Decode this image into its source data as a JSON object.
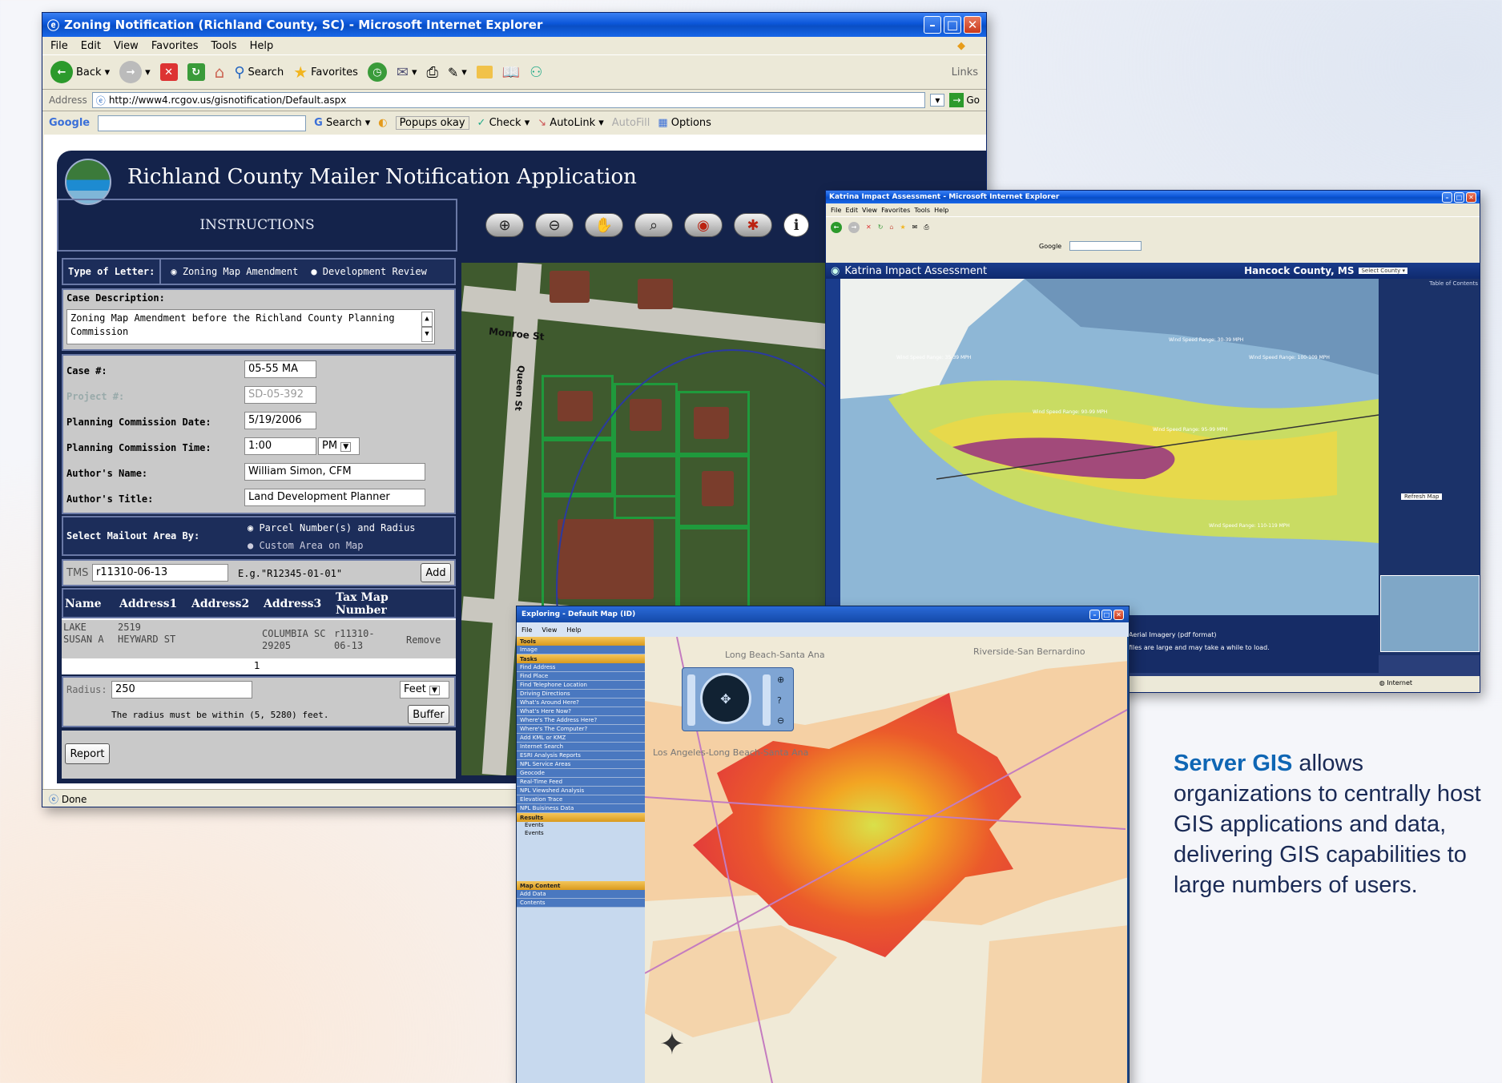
{
  "window_main": {
    "title": "Zoning Notification (Richland County, SC) - Microsoft Internet Explorer",
    "menu": [
      "File",
      "Edit",
      "View",
      "Favorites",
      "Tools",
      "Help"
    ],
    "toolbar": {
      "back": "Back",
      "search": "Search",
      "favorites": "Favorites",
      "links": "Links"
    },
    "address_label": "Address",
    "address_url": "http://www4.rcgov.us/gisnotification/Default.aspx",
    "go": "Go",
    "google": {
      "brand": "Google",
      "search": "Search",
      "popups": "Popups okay",
      "check": "Check",
      "autolink": "AutoLink",
      "autofill": "AutoFill",
      "options": "Options"
    },
    "status": "Done",
    "app": {
      "title": "Richland County Mailer Notification Application",
      "instructions": "INSTRUCTIONS",
      "type_of_letter_label": "Type of Letter:",
      "letter_options": [
        "Zoning Map Amendment",
        "Development Review"
      ],
      "case_description_label": "Case Description:",
      "case_description": "Zoning Map Amendment before the Richland County Planning Commission",
      "case_no_label": "Case #:",
      "case_no": "05-55 MA",
      "project_no_label": "Project #:",
      "project_no": "SD-05-392",
      "pc_date_label": "Planning Commission Date:",
      "pc_date": "5/19/2006",
      "pc_time_label": "Planning Commission Time:",
      "pc_time": "1:00",
      "pc_ampm": "PM",
      "author_name_label": "Author's Name:",
      "author_name": "William Simon, CFM",
      "author_title_label": "Author's Title:",
      "author_title": "Land Development Planner",
      "mailout_label": "Select Mailout Area By:",
      "mailout_options": [
        "Parcel Number(s) and Radius",
        "Custom Area on Map"
      ],
      "tms_label": "TMS",
      "tms_value": "r11310-06-13",
      "tms_example": "E.g.\"R12345-01-01\"",
      "add": "Add",
      "table_headers": [
        "Name",
        "Address1",
        "Address2",
        "Address3",
        "Tax Map Number",
        ""
      ],
      "table_rows": [
        [
          "LAKE SUSAN A",
          "2519 HEYWARD ST",
          "",
          "COLUMBIA SC 29205",
          "r11310-06-13",
          "Remove"
        ]
      ],
      "page_number": "1",
      "radius_label": "Radius:",
      "radius_value": "250",
      "radius_unit": "Feet",
      "radius_note": "The radius must be within (5, 5280) feet.",
      "buffer": "Buffer",
      "report": "Report",
      "streets": [
        "Monroe St",
        "Queen St"
      ],
      "tool_icons": [
        "zoom-in-icon",
        "zoom-out-icon",
        "pan-icon",
        "full-extent-icon",
        "select-icon",
        "clear-icon",
        "info-icon"
      ]
    }
  },
  "window_katrina": {
    "title": "Katrina Impact Assessment - Microsoft Internet Explorer",
    "header": "Katrina Impact Assessment",
    "county": "Hancock County, MS",
    "select": "Select County",
    "google": "Google",
    "toc_title": "Table of Contents",
    "refresh": "Refresh Map",
    "wind_labels": [
      "Wind Speed Range: 35-39 MPH",
      "Wind Speed Range: 90-99 MPH",
      "Wind Speed Range: 95-99 MPH",
      "Wind Speed Range: 110-119 MPH",
      "Wind Speed Range: 100-109 MPH",
      "Wind Speed Range: 30-39 MPH"
    ],
    "bottom_text": [
      "Aerial Imagery (pdf format)",
      "files are large and may take a while to load."
    ],
    "status": "Internet"
  },
  "window_explorer": {
    "title": "Exploring - Default Map (ID)",
    "menu": [
      "File",
      "View",
      "Help"
    ],
    "sections": {
      "tools": "Tools",
      "tools_items": [
        "Image"
      ],
      "tasks": "Tasks",
      "tasks_items": [
        "Find Address",
        "Find Place",
        "Find Telephone Location",
        "Driving Directions",
        "What's Around Here?",
        "What's Here Now?",
        "Where's The Address Here?",
        "Where's The Computer?",
        "Add KML or KMZ",
        "Internet Search",
        "ESRI Analysis Reports",
        "NPL Service Areas",
        "Geocode",
        "Real-Time Feed",
        "NPL Viewshed Analysis",
        "Elevation Trace",
        "NPL Buisiness Data"
      ],
      "results": "Results",
      "results_items": [
        "Events",
        "Events"
      ],
      "map_content": "Map Content",
      "map_content_items": [
        "Add Data",
        "Contents"
      ]
    },
    "place_labels": [
      "Long Beach-Santa Ana",
      "Los Angeles-Long Beach-Santa Ana",
      "Riverside-San Bernardino"
    ]
  },
  "caption": {
    "highlight": "Server GIS",
    "text": " allows organizations to centrally host GIS applications and data, delivering GIS capabilities to large numbers of users."
  }
}
